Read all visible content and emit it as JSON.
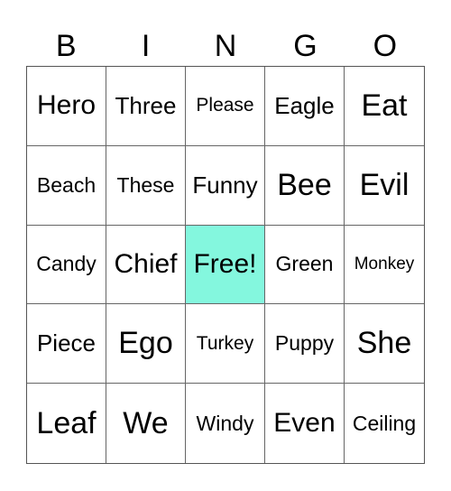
{
  "header": [
    "B",
    "I",
    "N",
    "G",
    "O"
  ],
  "free_color": "#84f7de",
  "cells": [
    {
      "text": "Hero",
      "size": "l"
    },
    {
      "text": "Three",
      "size": "m"
    },
    {
      "text": "Please",
      "size": "xs"
    },
    {
      "text": "Eagle",
      "size": "m"
    },
    {
      "text": "Eat",
      "size": "xl"
    },
    {
      "text": "Beach",
      "size": "s"
    },
    {
      "text": "These",
      "size": "s"
    },
    {
      "text": "Funny",
      "size": "m"
    },
    {
      "text": "Bee",
      "size": "xl"
    },
    {
      "text": "Evil",
      "size": "xl"
    },
    {
      "text": "Candy",
      "size": "s"
    },
    {
      "text": "Chief",
      "size": "l"
    },
    {
      "text": "Free!",
      "size": "l",
      "free": true
    },
    {
      "text": "Green",
      "size": "s"
    },
    {
      "text": "Monkey",
      "size": "xxs"
    },
    {
      "text": "Piece",
      "size": "m"
    },
    {
      "text": "Ego",
      "size": "xl"
    },
    {
      "text": "Turkey",
      "size": "xs"
    },
    {
      "text": "Puppy",
      "size": "s"
    },
    {
      "text": "She",
      "size": "xl"
    },
    {
      "text": "Leaf",
      "size": "xl"
    },
    {
      "text": "We",
      "size": "xl"
    },
    {
      "text": "Windy",
      "size": "s"
    },
    {
      "text": "Even",
      "size": "l"
    },
    {
      "text": "Ceiling",
      "size": "s"
    }
  ]
}
